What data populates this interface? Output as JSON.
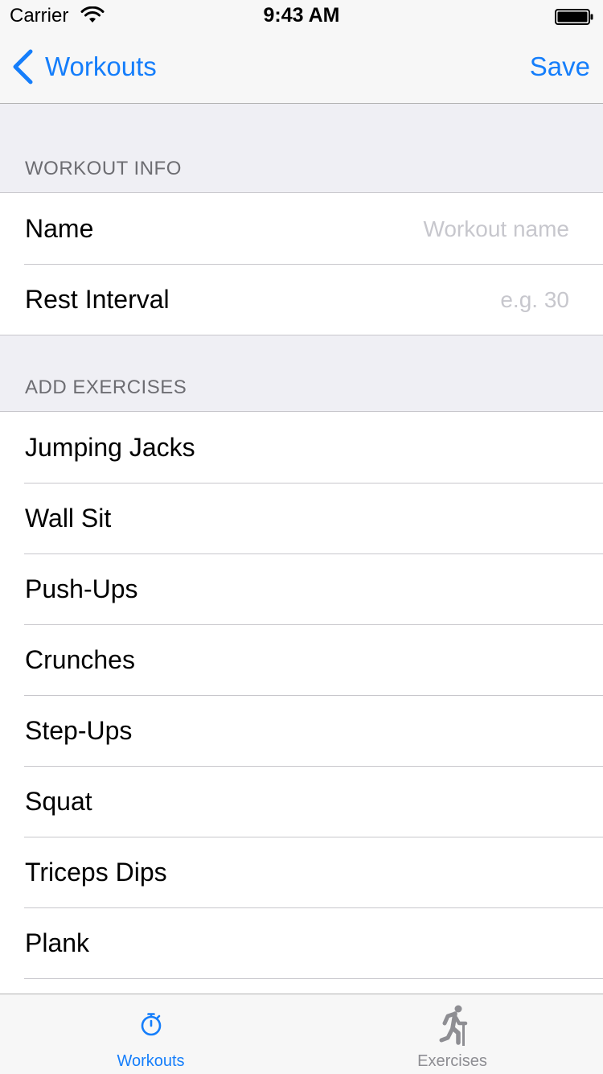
{
  "status_bar": {
    "carrier": "Carrier",
    "time": "9:43 AM"
  },
  "nav": {
    "back_label": "Workouts",
    "save_label": "Save"
  },
  "accent_color": "#157efb",
  "workout_info": {
    "header": "WORKOUT INFO",
    "name_label": "Name",
    "name_placeholder": "Workout name",
    "name_value": "",
    "rest_label": "Rest Interval",
    "rest_placeholder": "e.g. 30",
    "rest_value": ""
  },
  "add_exercises": {
    "header": "ADD EXERCISES",
    "items": [
      "Jumping Jacks",
      "Wall Sit",
      "Push-Ups",
      "Crunches",
      "Step-Ups",
      "Squat",
      "Triceps Dips",
      "Plank"
    ]
  },
  "tab_bar": {
    "tabs": [
      {
        "label": "Workouts",
        "icon": "stopwatch-icon",
        "selected": true
      },
      {
        "label": "Exercises",
        "icon": "running-person-icon",
        "selected": false
      }
    ]
  }
}
